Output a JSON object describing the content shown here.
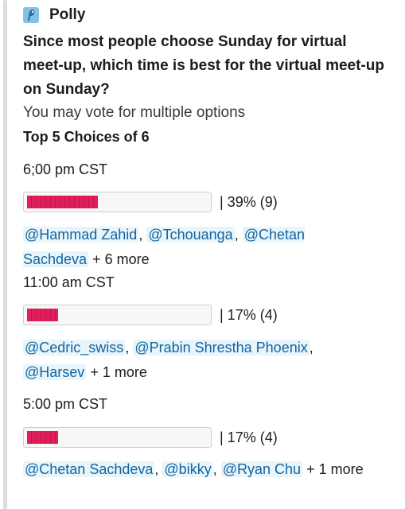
{
  "app": {
    "name": "Polly",
    "icon": "polly-logo-icon"
  },
  "poll": {
    "question": "Since most people choose Sunday for virtual meet-up, which time is best for the virtual meet-up on Sunday?",
    "subtitle": "You may vote for multiple options",
    "top_choices": "Top 5 Choices of 6",
    "options": [
      {
        "label": "6;00 pm CST",
        "result_text": "| 39% (9)",
        "fraction": 0.39,
        "voters": [
          "@Hammad Zahid",
          "@Tchouanga",
          "@Chetan Sachdeva"
        ],
        "more": "+ 6 more"
      },
      {
        "label": "11:00 am CST",
        "result_text": "| 17% (4)",
        "fraction": 0.17,
        "voters": [
          "@Cedric_swiss",
          "@Prabin Shrestha Phoenix",
          "@Harsev"
        ],
        "more": "+ 1 more"
      },
      {
        "label": "5:00 pm CST",
        "result_text": "| 17% (4)",
        "fraction": 0.17,
        "voters": [
          "@Chetan Sachdeva",
          "@bikky",
          "@Ryan Chu"
        ],
        "more": "+ 1 more"
      }
    ]
  },
  "colors": {
    "bar": "#e01e5a",
    "mention_text": "#1264a3",
    "mention_bg": "#e8f5fa"
  }
}
